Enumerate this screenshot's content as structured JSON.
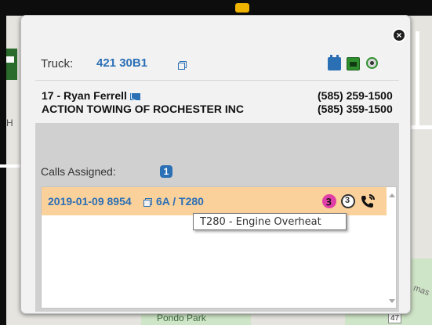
{
  "colors": {
    "accent": "#2b6fb5",
    "call_row_bg": "#fbd19b",
    "dispatch_pink": "#e13fa8",
    "tow_green": "#2f8f2f"
  },
  "map": {
    "label_left": "H",
    "label_park": "Pondo Park",
    "label_road_number": "47",
    "label_street": "mas"
  },
  "popup": {
    "close_icon": "close-circle-icon",
    "truck": {
      "label": "Truck:",
      "id": "421 30B1",
      "open_icon": "external-link-icon",
      "status_icons": [
        "battery-icon",
        "tow-truck-icon",
        "wheel-icon"
      ]
    },
    "driver": {
      "name": "17 - Ryan Ferrell",
      "mail_icon": "envelope-icon",
      "company": "ACTION TOWING OF ROCHESTER INC",
      "phone_1": "(585) 259-1500",
      "phone_2": "(585) 359-1500"
    },
    "calls": {
      "label": "Calls Assigned:",
      "count": "1",
      "items": [
        {
          "id": "2019-01-09 8954",
          "code": "6A / T280",
          "open_icon": "external-link-icon",
          "icons": [
            "dispatch-status-icon",
            "enroute-status-icon",
            "phone-call-icon"
          ],
          "status_glyph_1": "Ꝫ",
          "status_glyph_2": "3"
        }
      ]
    },
    "tooltip": "T280 - Engine Overheat"
  }
}
